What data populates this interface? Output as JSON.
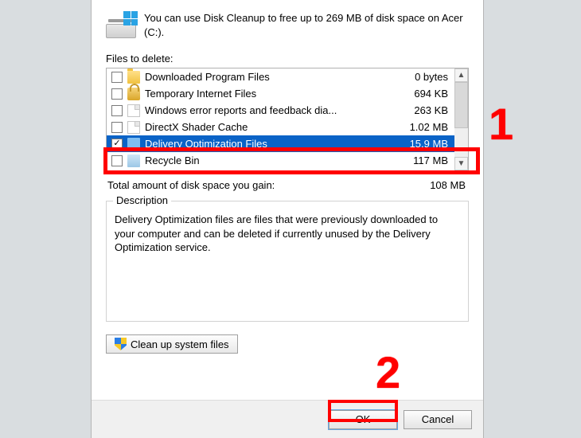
{
  "intro": "You can use Disk Cleanup to free up to 269 MB of disk space on Acer (C:).",
  "files_to_delete_label": "Files to delete:",
  "items": [
    {
      "name": "Downloaded Program Files",
      "size": "0 bytes",
      "checked": false,
      "icon": "folder"
    },
    {
      "name": "Temporary Internet Files",
      "size": "694 KB",
      "checked": false,
      "icon": "lock"
    },
    {
      "name": "Windows error reports and feedback dia...",
      "size": "263 KB",
      "checked": false,
      "icon": "page"
    },
    {
      "name": "DirectX Shader Cache",
      "size": "1.02 MB",
      "checked": false,
      "icon": "page"
    },
    {
      "name": "Delivery Optimization Files",
      "size": "15.9 MB",
      "checked": true,
      "icon": "blue",
      "selected": true
    },
    {
      "name": "Recycle Bin",
      "size": "117 MB",
      "checked": false,
      "icon": "bin"
    }
  ],
  "total_label": "Total amount of disk space you gain:",
  "total_value": "108 MB",
  "description_title": "Description",
  "description_text": "Delivery Optimization files are files that were previously downloaded to your computer and can be deleted if currently unused by the Delivery Optimization service.",
  "cleanup_button": "Clean up system files",
  "ok": "OK",
  "cancel": "Cancel",
  "annotations": {
    "marker1": "1",
    "marker2": "2"
  }
}
